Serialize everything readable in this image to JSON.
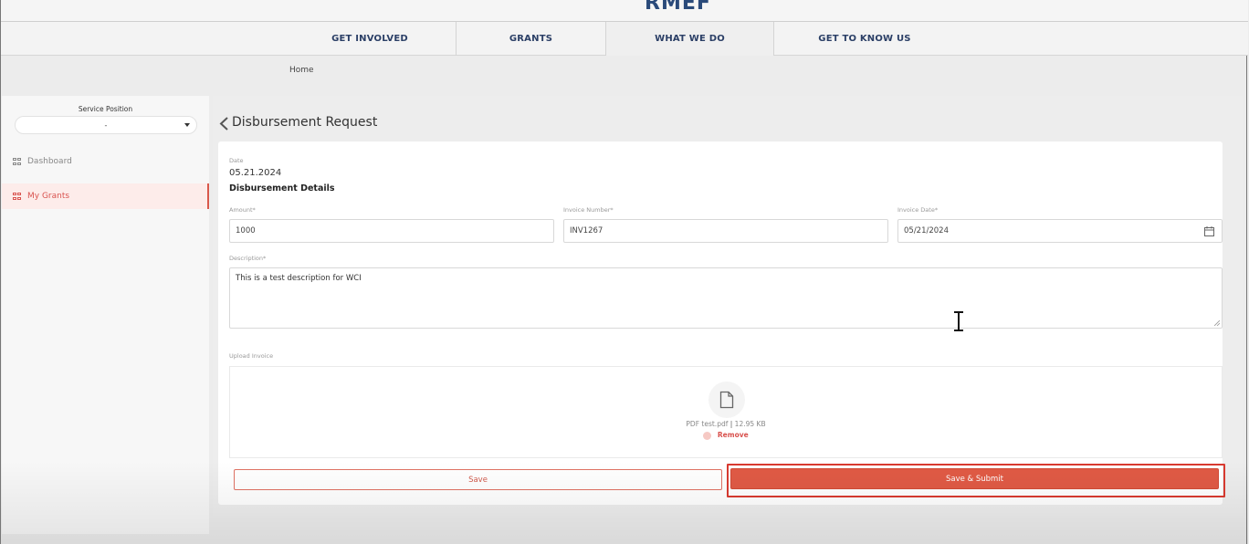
{
  "header": {
    "logo_text": "RMEF"
  },
  "nav": {
    "items": [
      {
        "label": "GET INVOLVED"
      },
      {
        "label": "GRANTS"
      },
      {
        "label": "WHAT WE DO"
      },
      {
        "label": "GET TO KNOW US"
      }
    ]
  },
  "breadcrumb": {
    "home": "Home"
  },
  "sidebar": {
    "service_position_label": "Service Position",
    "service_position_value": "-",
    "items": [
      {
        "label": "Dashboard",
        "active": false
      },
      {
        "label": "My Grants",
        "active": true
      }
    ]
  },
  "form": {
    "title": "Disbursement Request",
    "date_label": "Date",
    "date_value": "05.21.2024",
    "section_title": "Disbursement Details",
    "amount_label": "Amount*",
    "amount_value": "1000",
    "invoice_number_label": "Invoice Number*",
    "invoice_number_value": "INV1267",
    "invoice_date_label": "Invoice Date*",
    "invoice_date_value": "05/21/2024",
    "description_label": "Description*",
    "description_value": "This is a test description for WCI",
    "upload_label": "Upload Invoice",
    "file_name": "PDF test.pdf",
    "file_size": "12.95 KB",
    "remove_label": "Remove",
    "save_label": "Save",
    "submit_label": "Save & Submit"
  },
  "colors": {
    "accent": "#e05a45",
    "nav_text": "#2b3f66",
    "highlight_outline": "#d93a30"
  }
}
